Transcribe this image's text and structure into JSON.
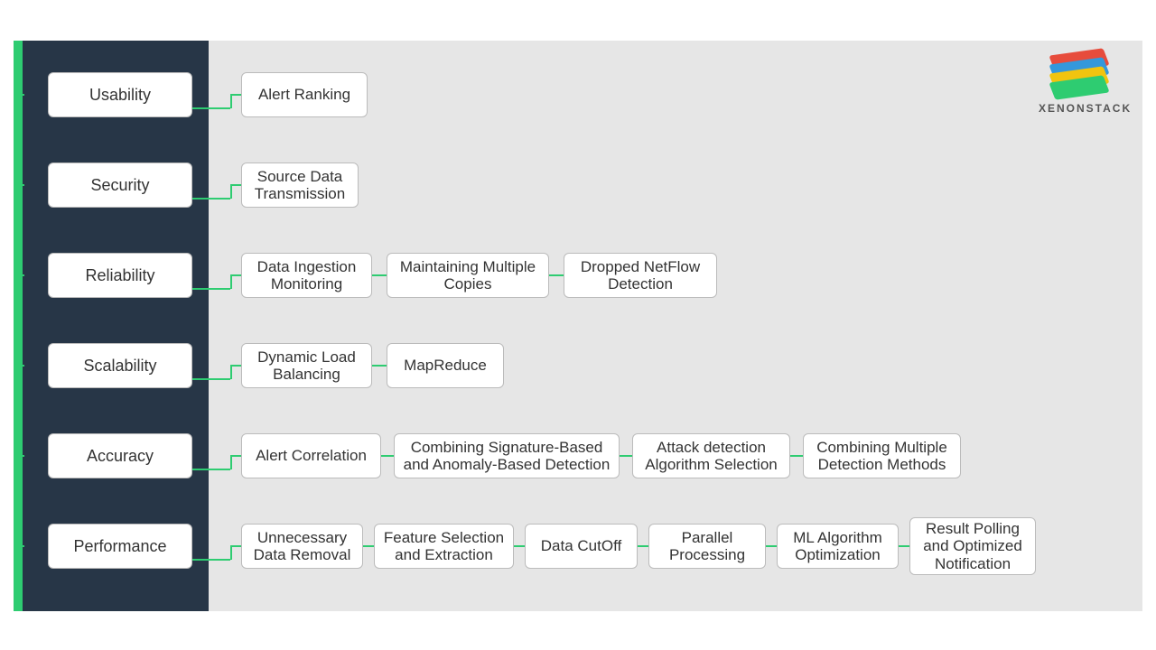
{
  "brand": "XENONSTACK",
  "rows": [
    {
      "category": "Usability",
      "leaves": [
        "Alert Ranking"
      ]
    },
    {
      "category": "Security",
      "leaves": [
        "Source Data Transmission"
      ]
    },
    {
      "category": "Reliability",
      "leaves": [
        "Data Ingestion Monitoring",
        "Maintaining Multiple Copies",
        "Dropped NetFlow Detection"
      ]
    },
    {
      "category": "Scalability",
      "leaves": [
        "Dynamic Load Balancing",
        "MapReduce"
      ]
    },
    {
      "category": "Accuracy",
      "leaves": [
        "Alert Correlation",
        "Combining Signature-Based and Anomaly-Based Detection",
        "Attack detection Algorithm Selection",
        "Combining Multiple Detection Methods"
      ]
    },
    {
      "category": "Performance",
      "leaves": [
        "Unnecessary Data Removal",
        "Feature Selection and Extraction",
        "Data CutOff",
        "Parallel Processing",
        "ML Algorithm Optimization",
        "Result Polling and Optimized Notification"
      ]
    }
  ]
}
